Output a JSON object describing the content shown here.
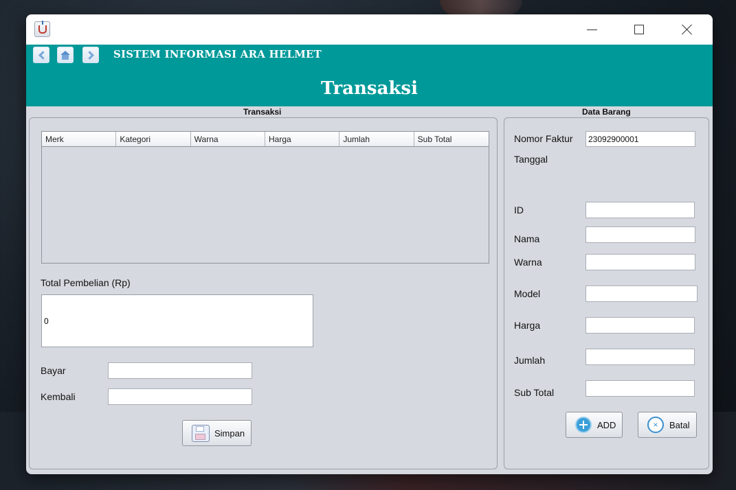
{
  "header": {
    "app_name": "SISTEM INFORMASI ARA HELMET",
    "page_title": "Transaksi"
  },
  "transaksi": {
    "group_title": "Transaksi",
    "table_columns": [
      "Merk",
      "Kategori",
      "Warna",
      "Harga",
      "Jumlah",
      "Sub Total"
    ],
    "total_label": "Total Pembelian (Rp)",
    "total_value": "0",
    "bayar_label": "Bayar",
    "bayar_value": "",
    "kembali_label": "Kembali",
    "kembali_value": "",
    "simpan_label": "Simpan"
  },
  "data_barang": {
    "group_title": "Data Barang",
    "nomor_faktur_label": "Nomor Faktur",
    "nomor_faktur_value": "23092900001",
    "tanggal_label": "Tanggal",
    "id_label": "ID",
    "nama_label": "Nama",
    "warna_label": "Warna",
    "model_label": "Model",
    "harga_label": "Harga",
    "jumlah_label": "Jumlah",
    "subtotal_label": "Sub Total",
    "add_label": "ADD",
    "batal_label": "Batal"
  },
  "colors": {
    "header_bg": "#009999",
    "panel_bg": "#d6d9df"
  }
}
